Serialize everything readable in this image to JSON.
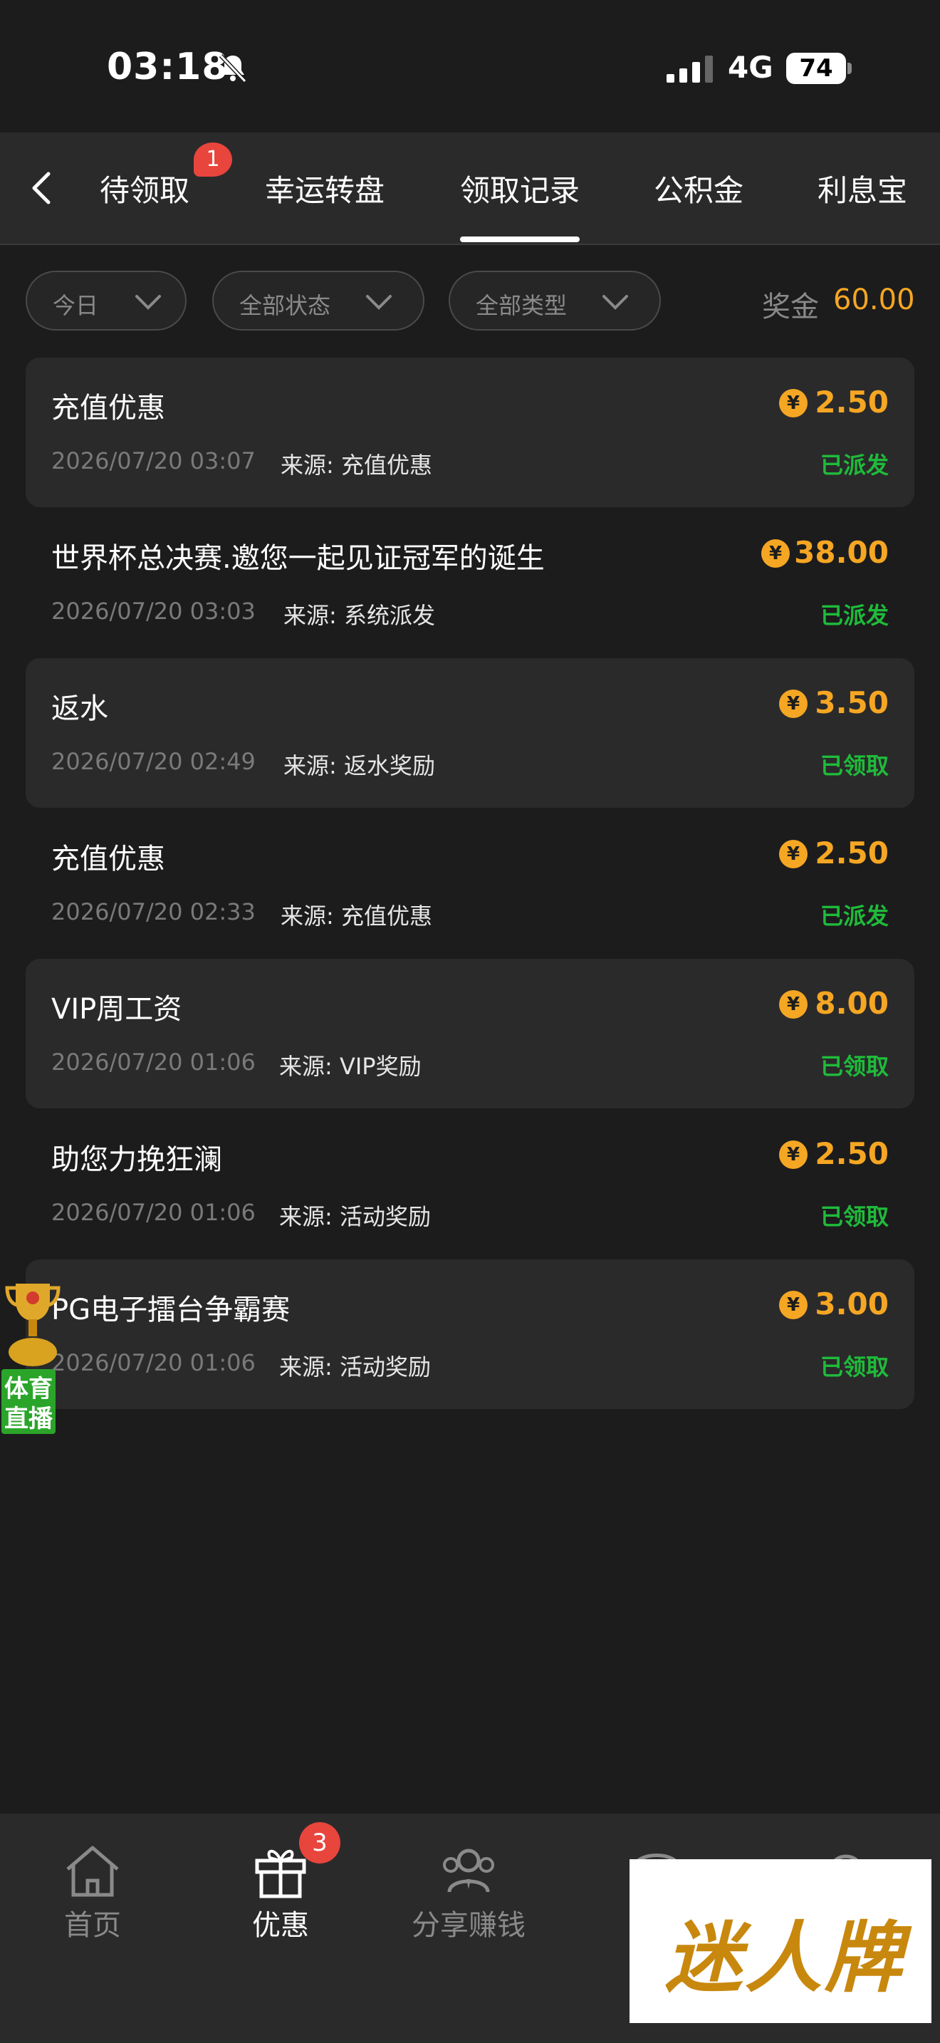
{
  "status_bar": {
    "time": "03:18",
    "network": "4G",
    "battery": "74"
  },
  "tabs": {
    "items": [
      "待领取",
      "幸运转盘",
      "领取记录",
      "公积金",
      "利息宝"
    ],
    "badge": "1",
    "active": "领取记录"
  },
  "filters": {
    "date": "今日",
    "status": "全部状态",
    "type": "全部类型",
    "bonus_label": "奖金",
    "bonus_value": "60.00"
  },
  "records": [
    {
      "title": "充值优惠",
      "date": "2026/07/20 03:07",
      "source": "来源: 充值优惠",
      "amount": "2.50",
      "status": "已派发"
    },
    {
      "title": "世界杯总决赛.邀您一起见证冠军的诞生",
      "date": "2026/07/20 03:03",
      "source": "来源: 系统派发",
      "amount": "38.00",
      "status": "已派发"
    },
    {
      "title": "返水",
      "date": "2026/07/20 02:49",
      "source": "来源: 返水奖励",
      "amount": "3.50",
      "status": "已领取"
    },
    {
      "title": "充值优惠",
      "date": "2026/07/20 02:33",
      "source": "来源: 充值优惠",
      "amount": "2.50",
      "status": "已派发"
    },
    {
      "title": "VIP周工资",
      "date": "2026/07/20 01:06",
      "source": "来源: VIP奖励",
      "amount": "8.00",
      "status": "已领取"
    },
    {
      "title": "助您力挽狂澜",
      "date": "2026/07/20 01:06",
      "source": "来源: 活动奖励",
      "amount": "2.50",
      "status": "已领取"
    },
    {
      "title": "PG电子擂台争霸赛",
      "date": "2026/07/20 01:06",
      "source": "来源: 活动奖励",
      "amount": "3.00",
      "status": "已领取"
    }
  ],
  "coin_symbol": "¥",
  "floating_badge": {
    "line1": "体育",
    "line2": "直播"
  },
  "bottom_nav": {
    "items": [
      "首页",
      "优惠",
      "分享赚钱"
    ],
    "badge": "3"
  },
  "ad": {
    "text": "迷人牌"
  },
  "colors": {
    "accent": "#f5a623",
    "status_green": "#1fbb3a",
    "badge_red": "#e8453c"
  }
}
